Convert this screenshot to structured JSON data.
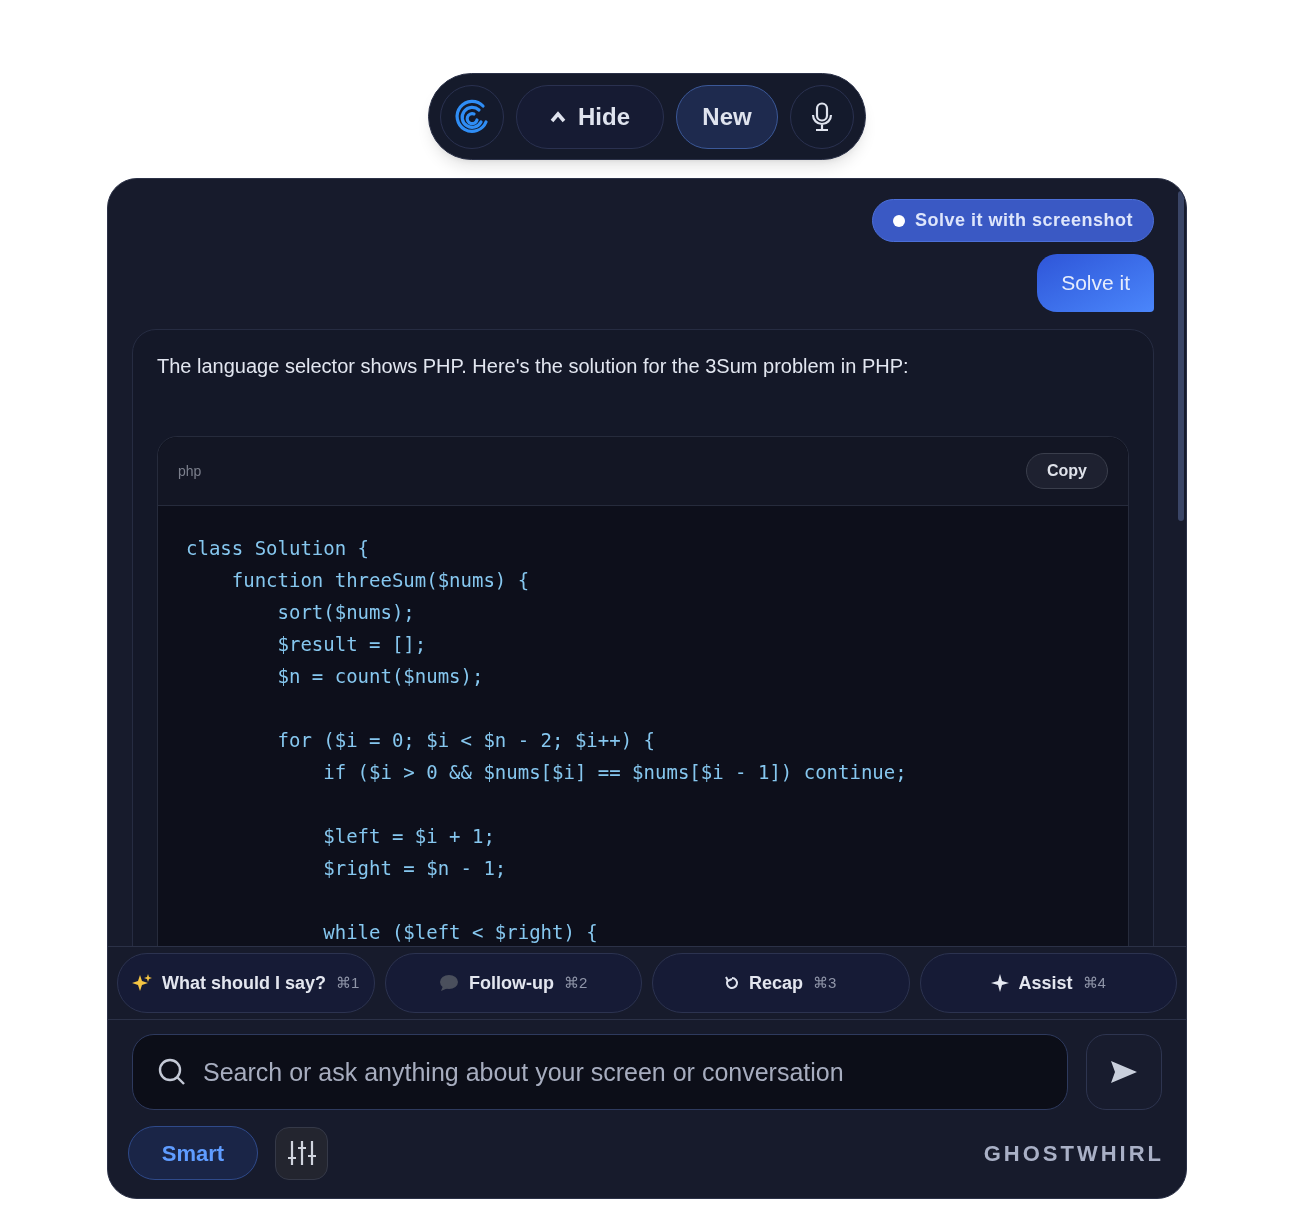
{
  "toolbar": {
    "hide_label": "Hide",
    "new_label": "New"
  },
  "messages": [
    {
      "kind": "chip",
      "text": "Solve it with screenshot"
    },
    {
      "kind": "bubble",
      "text": "Solve it"
    }
  ],
  "response": {
    "text": "The language selector shows PHP. Here's the solution for the 3Sum problem in PHP:",
    "code": {
      "language": "php",
      "copy_label": "Copy",
      "blocks": [
        [
          "class Solution {",
          "    function threeSum($nums) {",
          "        sort($nums);",
          "        $result = [];",
          "        $n = count($nums);"
        ],
        [
          "        for ($i = 0; $i < $n - 2; $i++) {",
          "            if ($i > 0 && $nums[$i] == $nums[$i - 1]) continue;"
        ],
        [
          "            $left = $i + 1;",
          "            $right = $n - 1;"
        ],
        [
          "            while ($left < $right) {"
        ]
      ]
    }
  },
  "quick_actions": [
    {
      "label": "What should I say?",
      "shortcut": "⌘1"
    },
    {
      "label": "Follow-up",
      "shortcut": "⌘2"
    },
    {
      "label": "Recap",
      "shortcut": "⌘3"
    },
    {
      "label": "Assist",
      "shortcut": "⌘4"
    }
  ],
  "input": {
    "placeholder": "Search or ask anything about your screen or conversation"
  },
  "mode_label": "Smart",
  "brand": "GHOSTWHIRL"
}
